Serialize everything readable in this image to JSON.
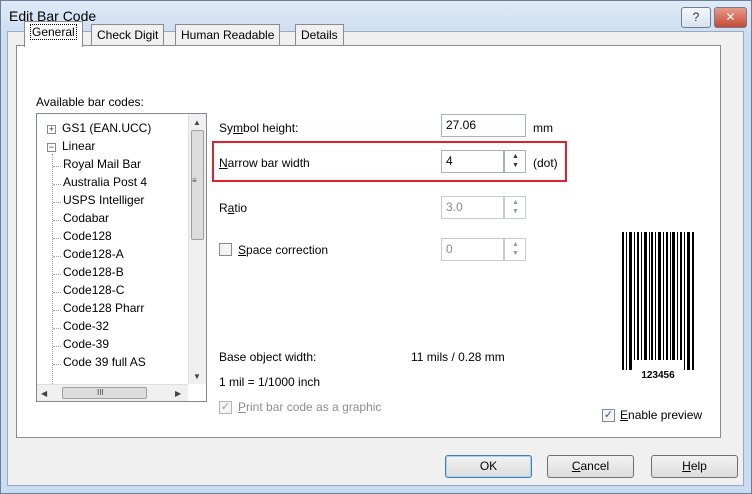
{
  "window": {
    "title": "Edit Bar Code",
    "help_glyph": "?",
    "close_glyph": "✕"
  },
  "tabs": [
    {
      "label": "General",
      "active": true
    },
    {
      "label": "Check Digit",
      "active": false
    },
    {
      "label": "Human Readable",
      "active": false
    },
    {
      "label": "Details",
      "active": false
    }
  ],
  "barcodes": {
    "label": "Available bar codes:",
    "items": [
      "GS1 (EAN.UCC)",
      "Linear",
      "Royal Mail Bar",
      "Australia Post 4",
      "USPS Intelliger",
      "Codabar",
      "Code128",
      "Code128-A",
      "Code128-B",
      "Code128-C",
      "Code128 Pharr",
      "Code-32",
      "Code-39",
      "Code 39 full AS"
    ],
    "selected": "Code128",
    "collapsed_glyph": "+",
    "expanded_glyph": "−"
  },
  "symbol_height": {
    "pre": "Sy",
    "mnemonic": "m",
    "post": "bol height:",
    "value": "27.06",
    "unit": "mm"
  },
  "narrow_bar_width": {
    "pre": "",
    "mnemonic": "N",
    "post": "arrow bar width",
    "value": "4",
    "unit": "(dot)"
  },
  "ratio": {
    "pre": "R",
    "mnemonic": "a",
    "post": "tio",
    "value": "3.0"
  },
  "space_correction": {
    "pre": "",
    "mnemonic": "S",
    "post": "pace correction",
    "value": "0",
    "checked": false
  },
  "base_object_width": {
    "label": "Base object width:",
    "value": "11 mils / 0.28 mm"
  },
  "mil_note": "1 mil = 1/1000 inch",
  "print_as_graphic": {
    "pre": "",
    "mnemonic": "P",
    "post": "rint bar code as a graphic",
    "checked": true
  },
  "preview": {
    "text": "123456"
  },
  "enable_preview": {
    "pre": "",
    "mnemonic": "E",
    "post": "nable preview",
    "checked": true
  },
  "buttons": {
    "ok": {
      "pre": "OK",
      "mnemonic": "",
      "post": ""
    },
    "cancel": {
      "pre": "",
      "mnemonic": "C",
      "post": "ancel"
    },
    "help": {
      "pre": "",
      "mnemonic": "H",
      "post": "elp"
    }
  },
  "icons": {
    "checkmark": "✓",
    "spin_up": "▲",
    "spin_down": "▼",
    "scroll_up": "▲",
    "scroll_down": "▼",
    "scroll_left": "◀",
    "scroll_right": "▶",
    "grip": "≡",
    "hgrip": "III"
  },
  "colors": {
    "highlight": "#e0202a",
    "title_bar": "#dfeaf7",
    "close": "#c54a34"
  }
}
